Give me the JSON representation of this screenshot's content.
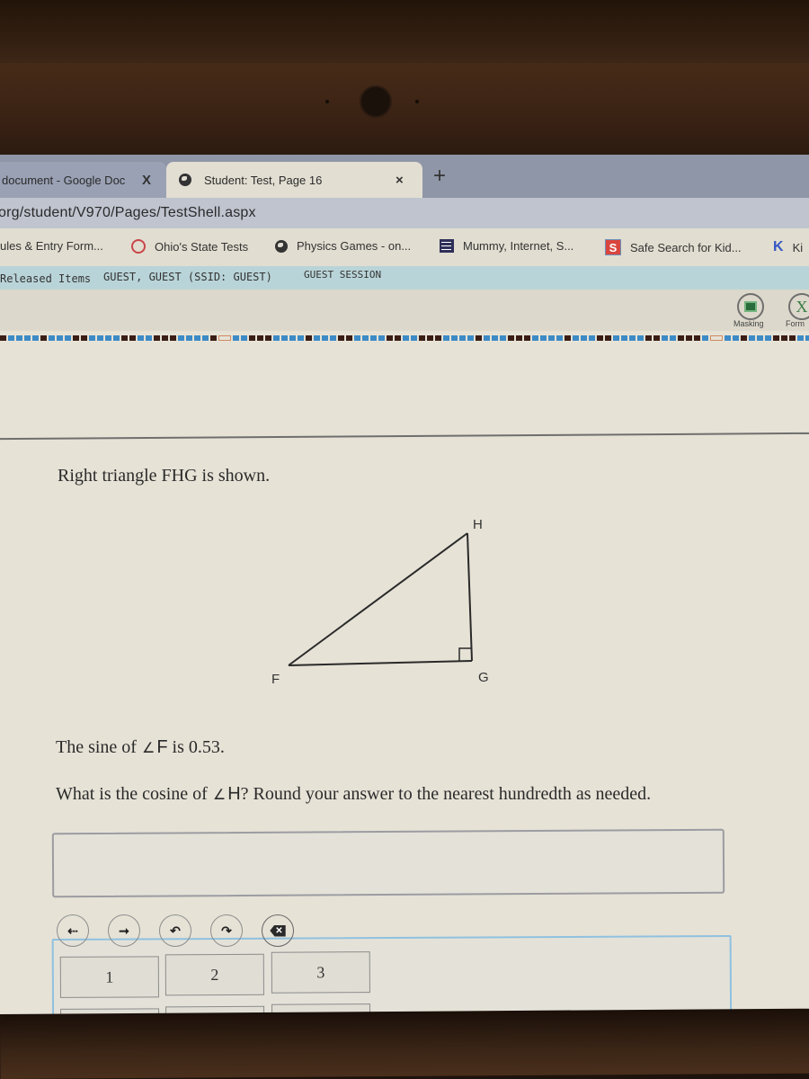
{
  "browser": {
    "tabs": [
      {
        "label": "document - Google Docs",
        "display": "document - Google Doc",
        "active": false
      },
      {
        "label": "Student: Test, Page 16",
        "active": true
      }
    ],
    "new_tab_label": "+",
    "close_label": "×",
    "close_label_inactive": "X",
    "address": "org/student/V970/Pages/TestShell.aspx",
    "bookmarks": [
      {
        "label": "ules & Entry Form...",
        "icon": "none"
      },
      {
        "label": "Ohio's State Tests",
        "icon": "ring-icon"
      },
      {
        "label": "Physics Games - on...",
        "icon": "globe-icon"
      },
      {
        "label": "Mummy, Internet, S...",
        "icon": "list-icon"
      },
      {
        "label": "Safe Search for Kid...",
        "icon": "safe-search-icon"
      },
      {
        "label": "Ki",
        "icon": "k-icon"
      }
    ],
    "safe_search_glyph": "S",
    "k_glyph": "K"
  },
  "app_header": {
    "released_items": "Released Items",
    "user": "GUEST, GUEST (SSID: GUEST)",
    "session": "GUEST SESSION",
    "tools": [
      {
        "label": "Masking",
        "icon": "masking-icon"
      },
      {
        "label": "Form",
        "icon": "formula-icon",
        "glyph": "X"
      }
    ]
  },
  "progress": {
    "current_question_marker": "outlined"
  },
  "question": {
    "intro": "Right triangle FHG is shown.",
    "given_prefix": "The sine of",
    "given_angle": "F",
    "given_suffix": "is 0.53.",
    "ask_prefix": "What is the cosine of",
    "ask_angle": "H",
    "ask_suffix": "? Round your answer to the nearest hundredth as needed.",
    "angle_symbol": "∠",
    "figure": {
      "vertices": [
        "F",
        "H",
        "G"
      ],
      "right_angle_at": "G"
    }
  },
  "answer": {
    "value": "",
    "controls": [
      {
        "name": "move-left",
        "glyph": "⇠"
      },
      {
        "name": "move-right",
        "glyph": "➞"
      },
      {
        "name": "undo",
        "glyph": "↶"
      },
      {
        "name": "redo",
        "glyph": "↷"
      },
      {
        "name": "delete",
        "glyph": "✕"
      }
    ],
    "keys": [
      "1",
      "2",
      "3"
    ]
  }
}
